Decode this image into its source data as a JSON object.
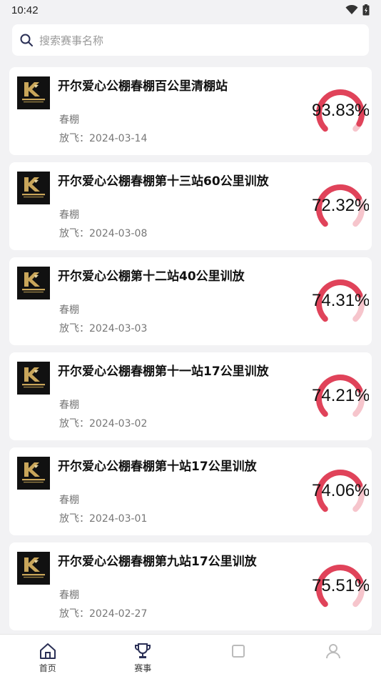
{
  "status_bar": {
    "time": "10:42"
  },
  "search": {
    "placeholder": "搜索赛事名称"
  },
  "races": [
    {
      "title": "开尔爱心公棚春棚百公里清棚站",
      "loft": "春棚",
      "date": "放飞：2024-03-14",
      "percent_text": "93.83%",
      "percent": 93.83
    },
    {
      "title": "开尔爱心公棚春棚第十三站60公里训放",
      "loft": "春棚",
      "date": "放飞：2024-03-08",
      "percent_text": "72.32%",
      "percent": 72.32
    },
    {
      "title": "开尔爱心公棚第十二站40公里训放",
      "loft": "春棚",
      "date": "放飞：2024-03-03",
      "percent_text": "74.31%",
      "percent": 74.31
    },
    {
      "title": "开尔爱心公棚春棚第十一站17公里训放",
      "loft": "春棚",
      "date": "放飞：2024-03-02",
      "percent_text": "74.21%",
      "percent": 74.21
    },
    {
      "title": "开尔爱心公棚春棚第十站17公里训放",
      "loft": "春棚",
      "date": "放飞：2024-03-01",
      "percent_text": "74.06%",
      "percent": 74.06
    },
    {
      "title": "开尔爱心公棚春棚第九站17公里训放",
      "loft": "春棚",
      "date": "放飞：2024-02-27",
      "percent_text": "75.51%",
      "percent": 75.51
    }
  ],
  "nav": {
    "items": [
      {
        "label": "首页",
        "icon": "home-icon"
      },
      {
        "label": "赛事",
        "icon": "trophy-icon"
      },
      {
        "label": "",
        "icon": "nav-icon-3"
      },
      {
        "label": "",
        "icon": "user-icon"
      }
    ]
  },
  "colors": {
    "gauge_fill": "#e0435a",
    "gauge_track": "#f6c5cc",
    "brand_gold": "#c9a65a"
  }
}
